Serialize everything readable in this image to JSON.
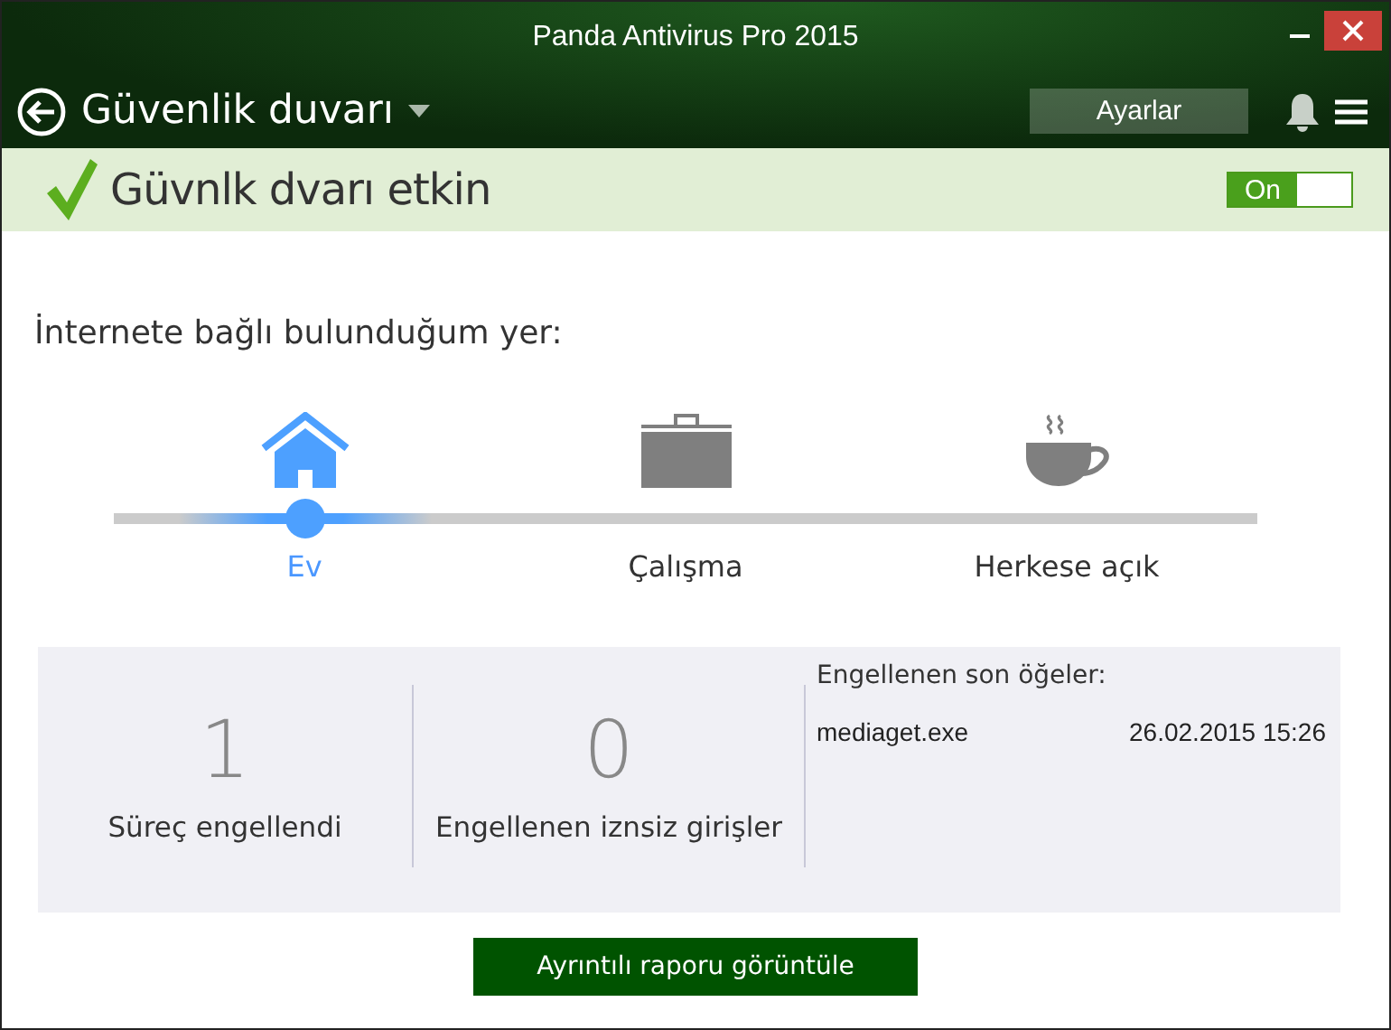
{
  "window": {
    "title": "Panda Antivirus Pro 2015"
  },
  "header": {
    "title": "Güvenlik duvarı",
    "settings_button": "Ayarlar"
  },
  "status": {
    "text": "Güvnlk dvarı etkin",
    "toggle": {
      "label": "On",
      "on": true
    }
  },
  "location": {
    "prompt": "İnternete bağlı bulunduğum yer:",
    "options": [
      {
        "kind": "home",
        "label": "Ev",
        "selected": true
      },
      {
        "kind": "work",
        "label": "Çalışma",
        "selected": false
      },
      {
        "kind": "public",
        "label": "Herkese açık",
        "selected": false
      }
    ]
  },
  "stats": [
    {
      "value": "1",
      "label": "Süreç engellendi"
    },
    {
      "value": "0",
      "label": "Engellenen iznsiz girişler"
    }
  ],
  "recent": {
    "title": "Engellenen son öğeler:",
    "items": [
      {
        "name": "mediaget.exe",
        "time": "26.02.2015 15:26"
      }
    ]
  },
  "report_button": "Ayrıntılı raporu görüntüle"
}
